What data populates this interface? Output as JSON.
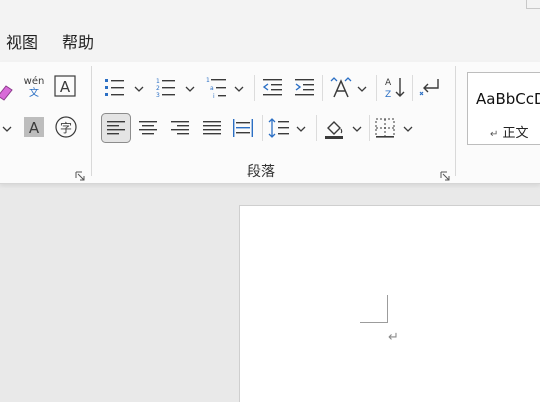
{
  "menubar": {
    "tabs": [
      {
        "label": "视图"
      },
      {
        "label": "帮助"
      }
    ]
  },
  "font_group": {
    "phonetic_icon_text": "wén",
    "phonetic_icon_sub": "文",
    "border_icon_text": "A",
    "shading_icon_text": "A",
    "enclose_icon_text": "字"
  },
  "paragraph_group": {
    "label": "段落"
  },
  "styles_group": {
    "sample_text": "AaBbCcDd",
    "style_name": "正文",
    "paragraph_mark": "↵"
  },
  "document": {
    "paragraph_mark": "↵"
  },
  "colors": {
    "accent_blue": "#2b6fc4",
    "icon_gray": "#3b3b3b",
    "selected_bg": "#e4e4e4"
  }
}
